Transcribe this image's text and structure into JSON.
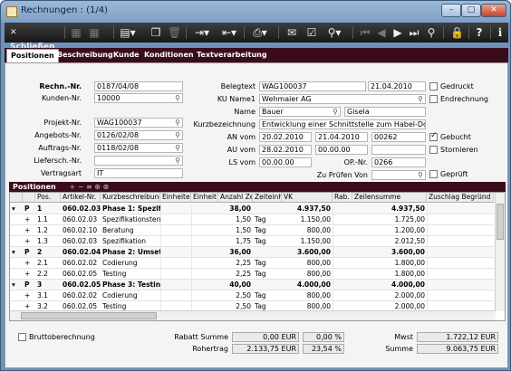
{
  "window": {
    "title": "Rechnungen : (1/4)",
    "btn_min": "–",
    "btn_max": "□",
    "btn_close": "✕"
  },
  "toolbar": {
    "close_label": "Schließen"
  },
  "tabs": [
    "Positionen",
    "Beschreibung",
    "Kunde",
    "Konditionen",
    "Textverarbeitung"
  ],
  "form": {
    "rechn_nr": {
      "label": "Rechn.-Nr.",
      "value": "0187/04/08"
    },
    "kunden_nr": {
      "label": "Kunden-Nr.",
      "value": "10000"
    },
    "projekt_nr": {
      "label": "Projekt-Nr.",
      "value": "WAG100037"
    },
    "angebots_nr": {
      "label": "Angebots-Nr.",
      "value": "0126/02/08"
    },
    "auftrags_nr": {
      "label": "Auftrags-Nr.",
      "value": "0118/02/08"
    },
    "liefersch_nr": {
      "label": "Liefersch.-Nr.",
      "value": ""
    },
    "vertragsart": {
      "label": "Vertragsart",
      "value": "IT"
    },
    "belegtext": {
      "label": "Belegtext",
      "value": "WAG100037",
      "date": "21.04.2010"
    },
    "ku_name1": {
      "label": "KU Name1",
      "value": "Wehmaier AG"
    },
    "name": {
      "label": "Name",
      "value": "Bauer",
      "value2": "Gisela"
    },
    "kurzbezeichnung": {
      "label": "Kurzbezeichnung",
      "value": "Entwicklung einer Schnittstelle zum Habel-Dokum"
    },
    "an_vom": {
      "label": "AN vom",
      "v1": "20.02.2010",
      "v2": "21.04.2010",
      "v3": "00262"
    },
    "au_vom": {
      "label": "AU vom",
      "v1": "28.02.2010",
      "v2": "00.00.00"
    },
    "ls_vom": {
      "label": "LS vom",
      "v1": "00.00.00"
    },
    "op_nr": {
      "label": "OP.-Nr.",
      "value": "0266"
    },
    "zu_pruefen": {
      "label": "Zu Prüfen Von",
      "value": ""
    },
    "checks": {
      "gedruckt": "Gedruckt",
      "endrechnung": "Endrechnung",
      "gebucht": "Gebucht",
      "stornieren": "Stornieren",
      "geprueft": "Geprüft"
    }
  },
  "grid": {
    "title": "Positionen",
    "tools": "+ − ≡ ⊕ ⊗",
    "columns": [
      "Pos.",
      "Artikel-Nr.",
      "Kurzbeschreibung",
      "Einheiten",
      "Einheit",
      "Anzahl Ze",
      "Zeiteinh",
      "VK",
      "Rab.",
      "Zeilensumme",
      "Zuschlag Begründ"
    ],
    "rows": [
      {
        "tree": "▾",
        "type": "P",
        "pos": "1",
        "art": "060.02.03",
        "desc": "Phase 1: Spezifikz",
        "anz": "38,00",
        "unit": "",
        "vk": "4.937,50",
        "sum": "4.937,50",
        "bold": true
      },
      {
        "tree": "",
        "type": "+",
        "pos": "1.1",
        "art": "060.02.03",
        "desc": "Spezifikationsterm",
        "anz": "1,50",
        "unit": "Tag",
        "vk": "1.150,00",
        "sum": "1.725,00",
        "bold": false
      },
      {
        "tree": "",
        "type": "+",
        "pos": "1.2",
        "art": "060.02.10",
        "desc": "Beratung",
        "anz": "1,50",
        "unit": "Tag",
        "vk": "800,00",
        "sum": "1.200,00",
        "bold": false
      },
      {
        "tree": "",
        "type": "+",
        "pos": "1.3",
        "art": "060.02.03",
        "desc": "Spezifikation",
        "anz": "1,75",
        "unit": "Tag",
        "vk": "1.150,00",
        "sum": "2.012,50",
        "bold": false
      },
      {
        "tree": "▾",
        "type": "P",
        "pos": "2",
        "art": "060.02.04",
        "desc": "Phase 2: Umsetzu",
        "anz": "36,00",
        "unit": "",
        "vk": "3.600,00",
        "sum": "3.600,00",
        "bold": true
      },
      {
        "tree": "",
        "type": "+",
        "pos": "2.1",
        "art": "060.02.02",
        "desc": "Codierung",
        "anz": "2,25",
        "unit": "Tag",
        "vk": "800,00",
        "sum": "1.800,00",
        "bold": false
      },
      {
        "tree": "",
        "type": "+",
        "pos": "2.2",
        "art": "060.02.05",
        "desc": "Testing",
        "anz": "2,25",
        "unit": "Tag",
        "vk": "800,00",
        "sum": "1.800,00",
        "bold": false
      },
      {
        "tree": "▾",
        "type": "P",
        "pos": "3",
        "art": "060.02.05",
        "desc": "Phase 3: Testing",
        "anz": "40,00",
        "unit": "",
        "vk": "4.000,00",
        "sum": "4.000,00",
        "bold": true
      },
      {
        "tree": "",
        "type": "+",
        "pos": "3.1",
        "art": "060.02.02",
        "desc": "Codierung",
        "anz": "2,50",
        "unit": "Tag",
        "vk": "800,00",
        "sum": "2.000,00",
        "bold": false
      },
      {
        "tree": "",
        "type": "+",
        "pos": "3.2",
        "art": "060.02.05",
        "desc": "Testing",
        "anz": "2,50",
        "unit": "Tag",
        "vk": "800,00",
        "sum": "2.000,00",
        "bold": false
      }
    ]
  },
  "footer": {
    "brutto": "Bruttoberechnung",
    "rabatt_label": "Rabatt Summe",
    "rabatt_value": "0,00 EUR",
    "rabatt_pct": "0,00 %",
    "rohertrag_label": "Rohertrag",
    "rohertrag_value": "2.133,75 EUR",
    "rohertrag_pct": "23,54 %",
    "mwst_label": "Mwst",
    "mwst_value": "1.722,12 EUR",
    "summe_label": "Summe",
    "summe_value": "9.063,75 EUR"
  }
}
